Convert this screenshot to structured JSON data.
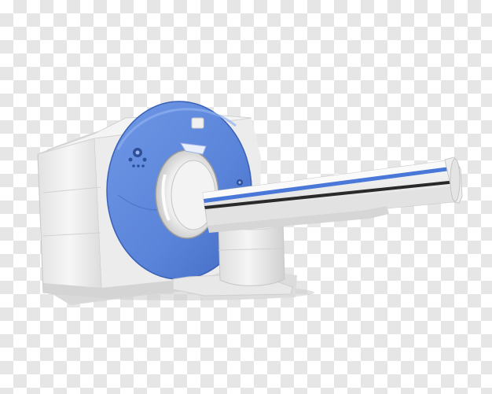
{
  "image": {
    "subject": "ct-scanner",
    "background": "transparency-checkerboard",
    "colors": {
      "checker_light": "#ffffff",
      "checker_dark": "#e6e6e6",
      "gantry_blue": "#5b86dd",
      "gantry_blue_dark": "#3f66bf",
      "body_white": "#f2f2f2",
      "body_shadow": "#d6d6d6",
      "stripe_blue": "#4a78d8",
      "stripe_dark": "#2a2a2a"
    }
  }
}
